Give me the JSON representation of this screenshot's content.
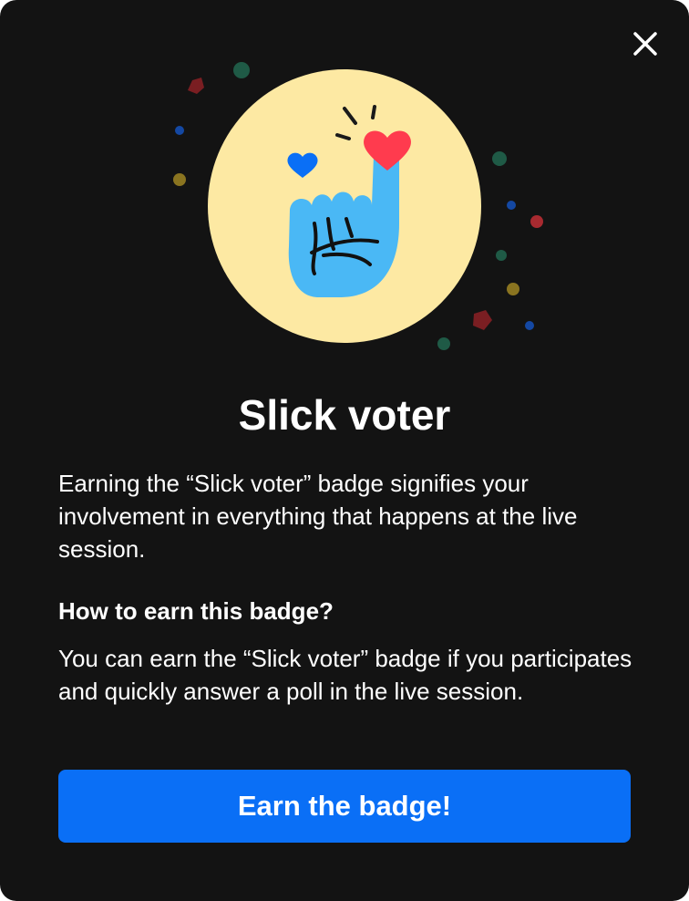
{
  "dialog": {
    "close_icon": "close-icon",
    "badge_icon": "pointing-finger-hearts-icon",
    "title": "Slick voter",
    "description": "Earning the “Slick voter” badge signifies your involvement in everything that happens at the live session.",
    "how_heading": "How to earn this badge?",
    "how_text": "You can earn the “Slick voter” badge if you participates and quickly answer a poll in the live session.",
    "cta_label": "Earn the badge!"
  },
  "colors": {
    "background": "#131313",
    "badge_circle": "#fde9a3",
    "hand": "#4ab8f5",
    "heart_red": "#ff3b4e",
    "heart_blue": "#0a6ff6",
    "accent_button": "#0a6ff6",
    "text": "#ffffff"
  }
}
